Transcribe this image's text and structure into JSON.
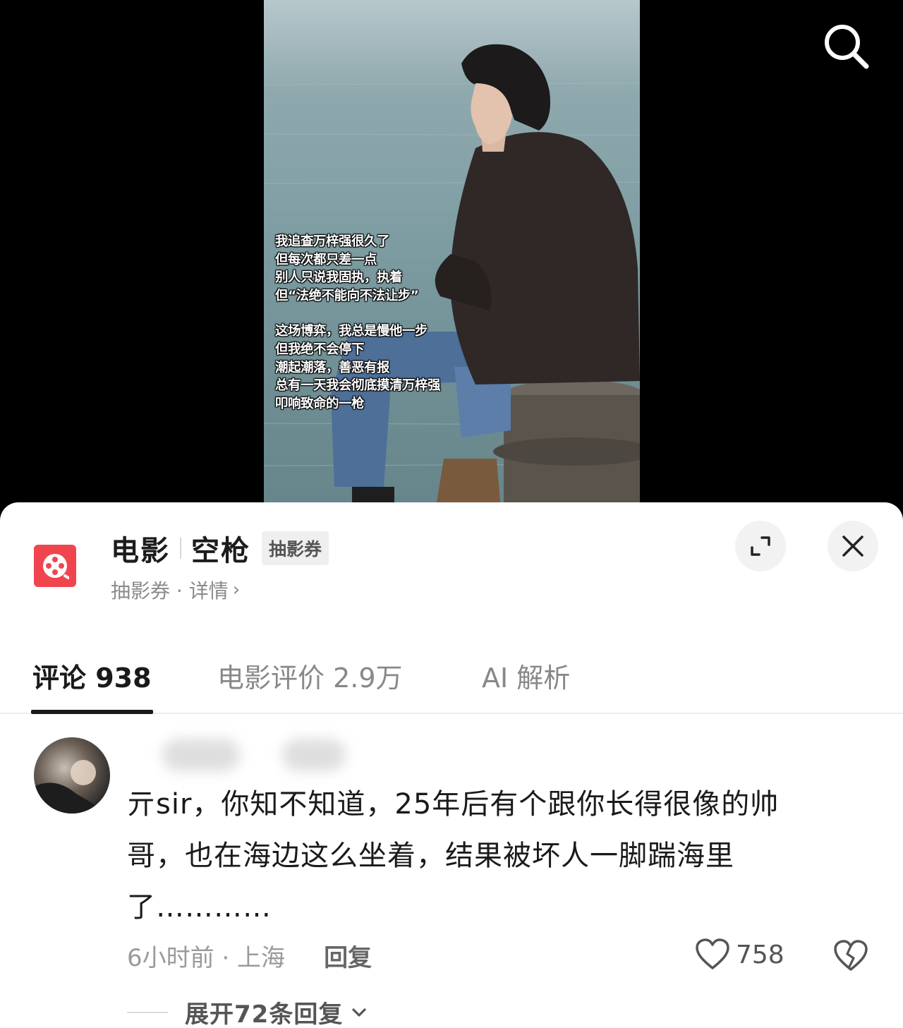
{
  "video": {
    "overlay_lines": [
      "我追查万梓强很久了",
      "但每次都只差一点",
      "别人只说我固执，执着",
      "但“法绝不能向不法让步”",
      "",
      "这场博弈，我总是慢他一步",
      "但我绝不会停下",
      "潮起潮落，善恶有报",
      "总有一天我会彻底摸清万梓强",
      "叩响致命的一枪"
    ]
  },
  "header": {
    "category": "电影",
    "movie_title": "空枪",
    "tag": "抽影券",
    "subtitle": "抽影券 · 详情",
    "subtitle_chevron": "›"
  },
  "tabs": [
    {
      "label": "评论 938",
      "active": true
    },
    {
      "label": "电影评价 2.9万",
      "active": false
    },
    {
      "label": "AI 解析",
      "active": false
    }
  ],
  "comment": {
    "text": "亓sir，你知不知道，25年后有个跟你长得很像的帅哥，也在海边这么坐着，结果被坏人一脚踹海里了…………",
    "time_location": "6小时前 · 上海",
    "reply_label": "回复",
    "like_count": "758",
    "expand_label": "展开72条回复"
  },
  "icons": {
    "search": "search-icon",
    "expand": "expand-icon",
    "close": "close-icon",
    "like": "heart-icon",
    "dislike": "broken-heart-icon",
    "chevron": "chevron-down-icon",
    "logo": "film-reel-icon"
  },
  "colors": {
    "logo_bg": "#f0454f",
    "active_tab": "#1a1a1a",
    "muted_text": "#8a8a8a"
  }
}
